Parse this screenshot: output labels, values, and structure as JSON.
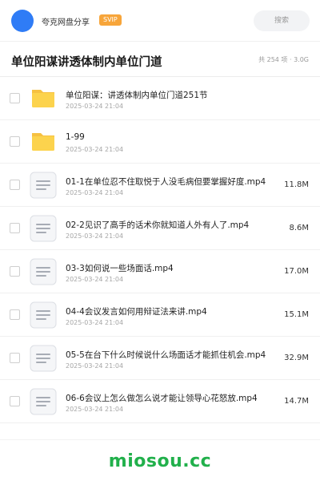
{
  "topbar": {
    "username": "夸克网盘分享",
    "badge": "SVIP",
    "search_placeholder": "搜索",
    "avatar_color": "#2f7cf6",
    "badge_color": "#f7a53a"
  },
  "header": {
    "title": "单位阳谋讲透体制内单位门道",
    "item_count": "共 254 项",
    "separator": "·",
    "total_size": "3.0G"
  },
  "files": [
    {
      "type": "folder-icon",
      "name": "单位阳谋：讲透体制内单位门道251节",
      "date": "2025-03-24 21:04",
      "size": ""
    },
    {
      "type": "folder-icon",
      "name": "1-99",
      "date": "2025-03-24 21:04",
      "size": ""
    },
    {
      "type": "document-icon",
      "name": "01-1在单位忍不住取悦于人没毛病但要掌握好度.mp4",
      "date": "2025-03-24 21:04",
      "size": "11.8M"
    },
    {
      "type": "document-icon",
      "name": "02-2见识了高手的话术你就知道人外有人了.mp4",
      "date": "2025-03-24 21:04",
      "size": "8.6M"
    },
    {
      "type": "document-icon",
      "name": "03-3如何说一些场面话.mp4",
      "date": "2025-03-24 21:04",
      "size": "17.0M"
    },
    {
      "type": "document-icon",
      "name": "04-4会议发言如何用辩证法来讲.mp4",
      "date": "2025-03-24 21:04",
      "size": "15.1M"
    },
    {
      "type": "document-icon",
      "name": "05-5在台下什么时候说什么场面话才能抓住机会.mp4",
      "date": "2025-03-24 21:04",
      "size": "32.9M"
    },
    {
      "type": "document-icon",
      "name": "06-6会议上怎么做怎么说才能让领导心花怒放.mp4",
      "date": "2025-03-24 21:04",
      "size": "14.7M"
    }
  ],
  "footer": {
    "watermark": "miosou.cc",
    "watermark_color": "#21b04b"
  }
}
